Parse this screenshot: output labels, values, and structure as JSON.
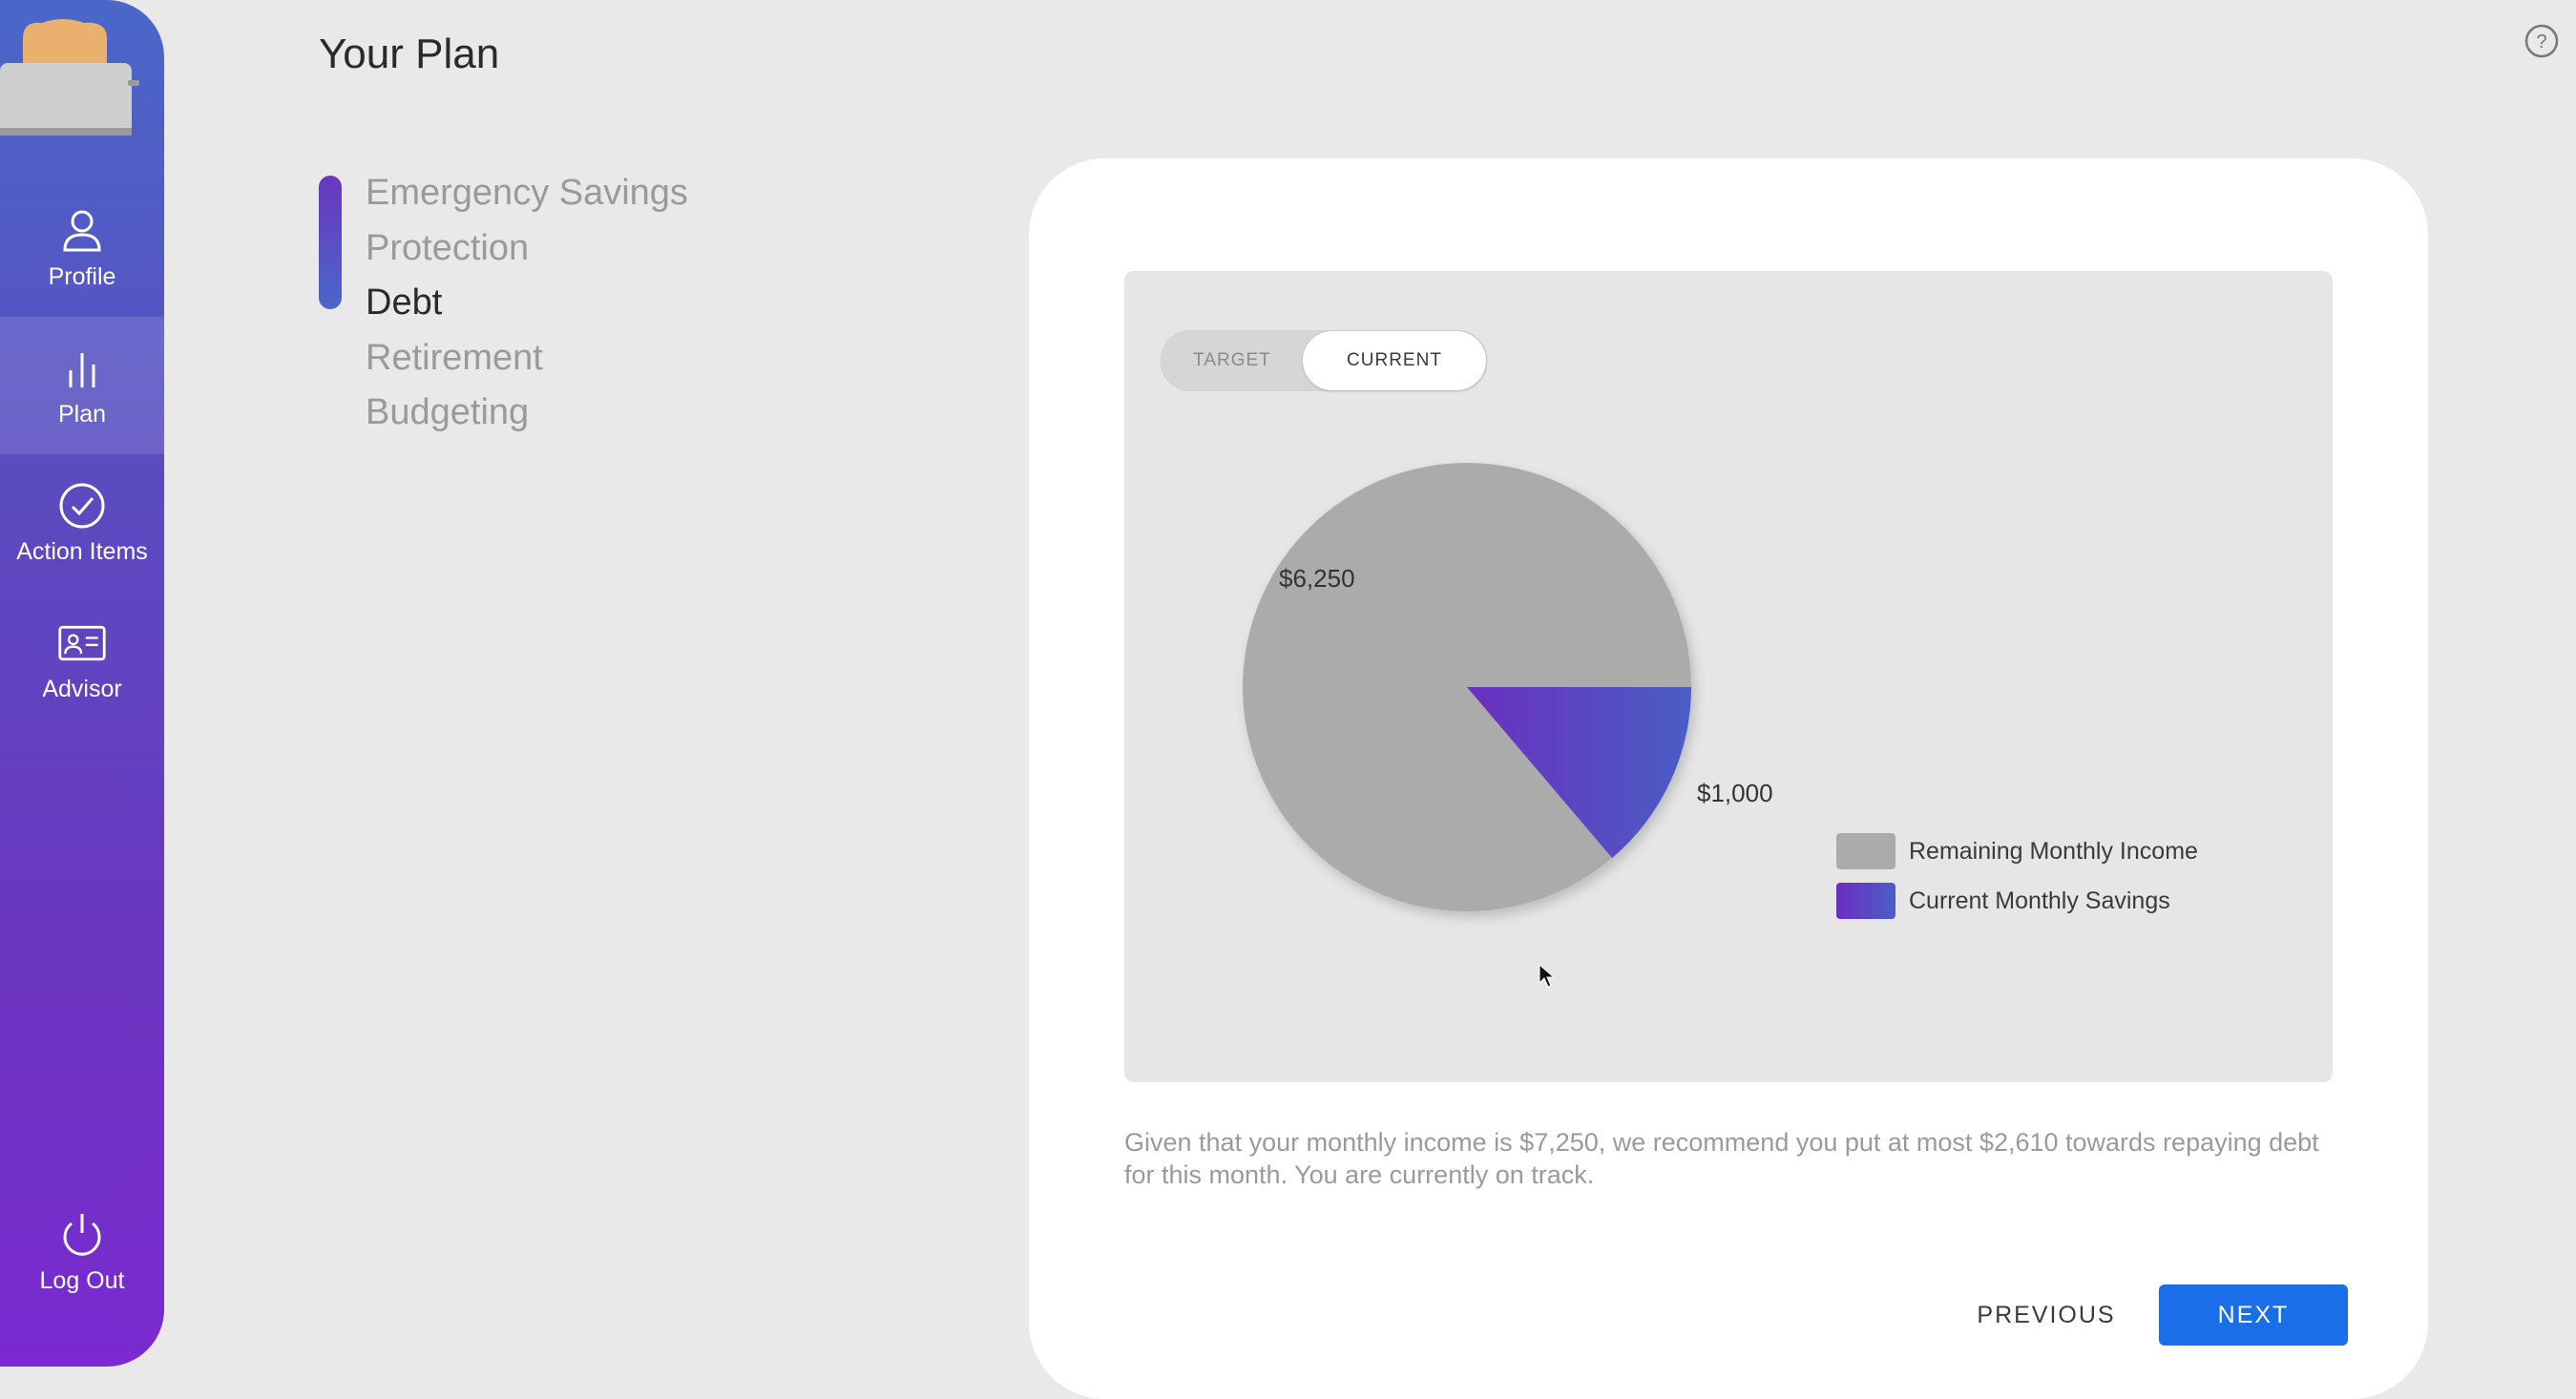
{
  "sidebar": {
    "items": [
      {
        "label": "Profile",
        "icon": "person-icon"
      },
      {
        "label": "Plan",
        "icon": "bar-chart-icon",
        "active": true
      },
      {
        "label": "Action Items",
        "icon": "check-circle-icon"
      },
      {
        "label": "Advisor",
        "icon": "id-card-icon"
      }
    ],
    "logout": {
      "label": "Log Out",
      "icon": "power-icon"
    }
  },
  "header": {
    "title": "Your Plan"
  },
  "steps": [
    {
      "label": "Emergency Savings"
    },
    {
      "label": "Protection"
    },
    {
      "label": "Debt",
      "current": true
    },
    {
      "label": "Retirement"
    },
    {
      "label": "Budgeting"
    }
  ],
  "toggle": {
    "target_label": "TARGET",
    "current_label": "CURRENT",
    "selected": "CURRENT"
  },
  "chart_data": {
    "type": "pie",
    "slices": [
      {
        "name": "Remaining Monthly Income",
        "value": 6250,
        "label": "$6,250",
        "color": "#ababab"
      },
      {
        "name": "Current Monthly Savings",
        "value": 1000,
        "label": "$1,000",
        "color": "#5a44c4"
      }
    ],
    "legend_position": "right"
  },
  "description": "Given that your monthly income is $7,250, we recommend you put at most $2,610 towards repaying debt for this month. You are currently on track.",
  "buttons": {
    "previous": "PREVIOUS",
    "next": "NEXT"
  },
  "colors": {
    "accent": "#1a6ee8",
    "gradient_top": "#4a67c9",
    "gradient_bottom": "#7a2ad0"
  }
}
